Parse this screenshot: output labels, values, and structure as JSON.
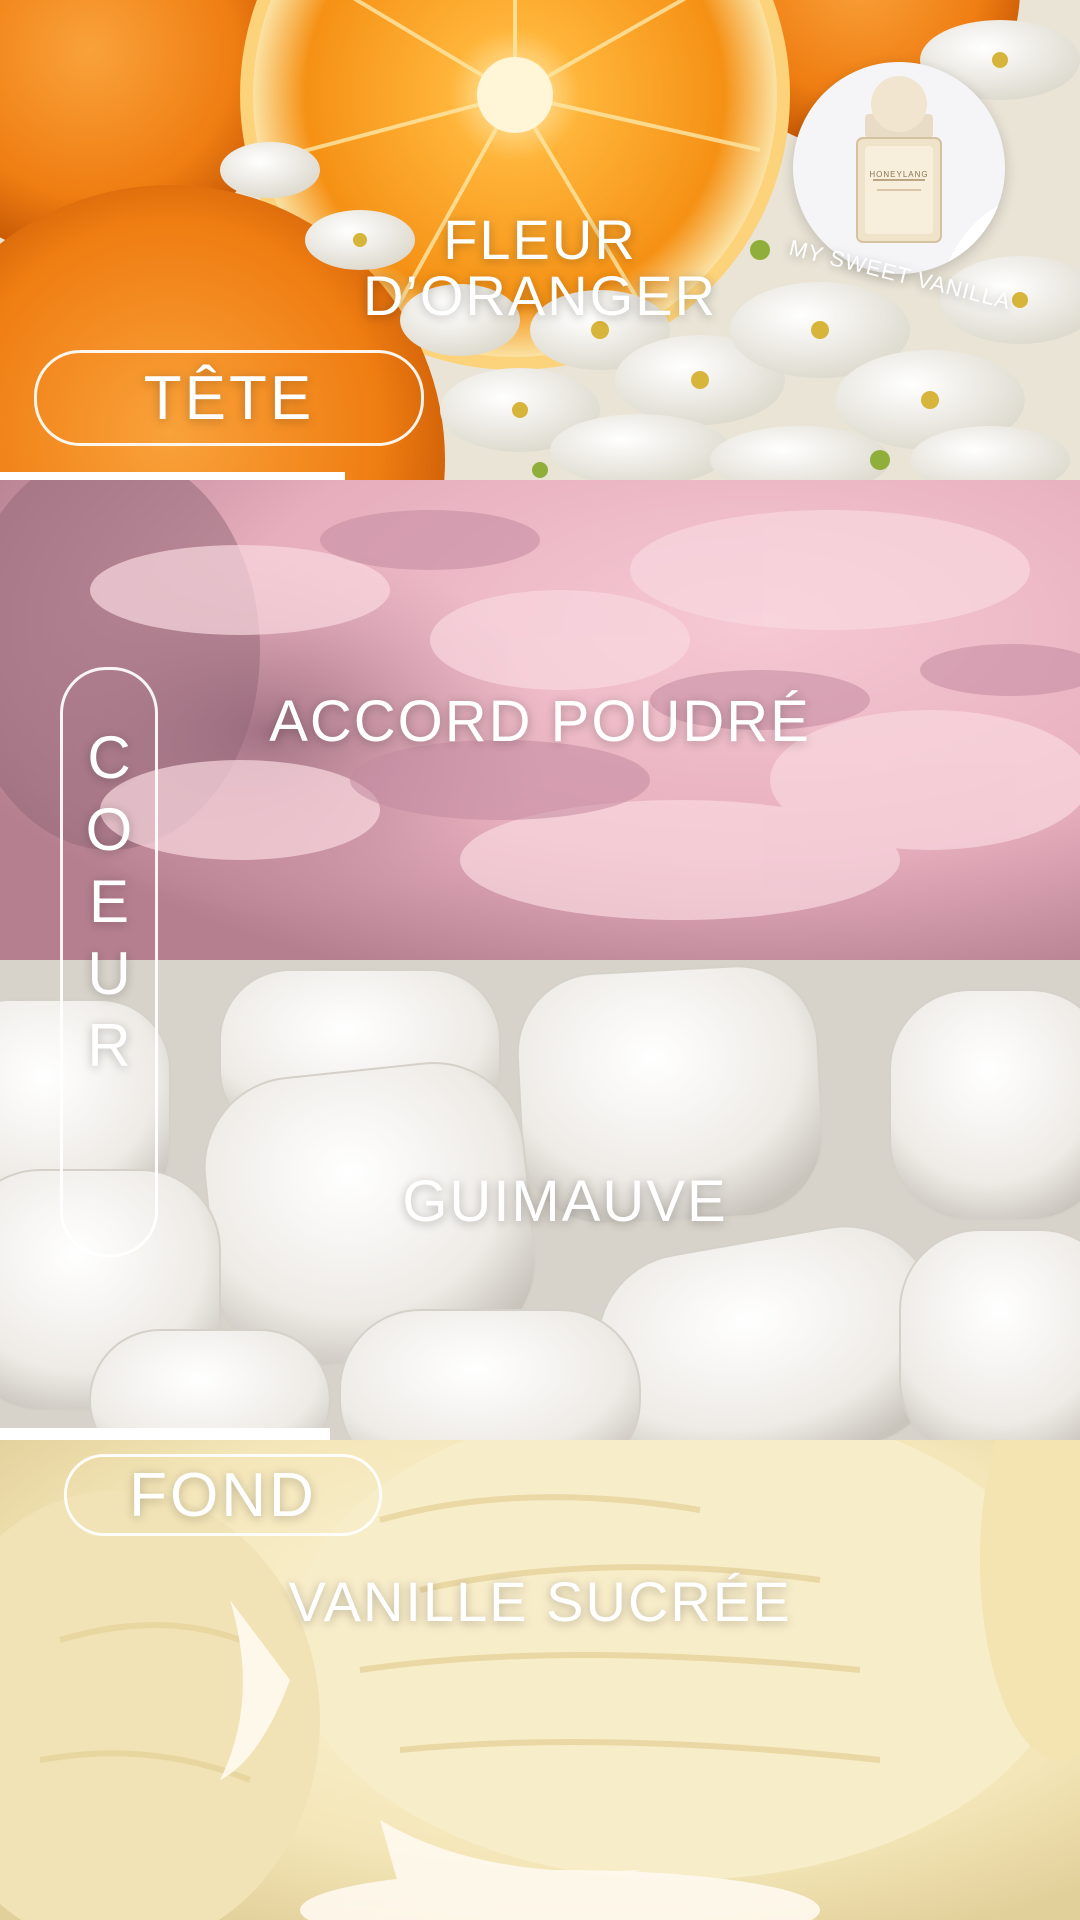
{
  "sections": {
    "tete": {
      "tier_label": "TÊTE",
      "note_line1": "FLEUR",
      "note_line2": "D’ORANGER"
    },
    "coeur": {
      "tier_label": "COEUR",
      "note": "ACCORD POUDRÉ",
      "note_secondary": "GUIMAUVE"
    },
    "fond": {
      "tier_label": "FOND",
      "note": "VANILLE SUCRÉE"
    }
  },
  "product": {
    "bottle_brand": "HONEYLANG",
    "name_arc": "MY SWEET VANILLA"
  },
  "colors": {
    "orange": "#f28a1a",
    "pink_powder": "#e9b4c4",
    "marshmallow": "#f4f2ee",
    "vanilla": "#f6ecc7"
  }
}
